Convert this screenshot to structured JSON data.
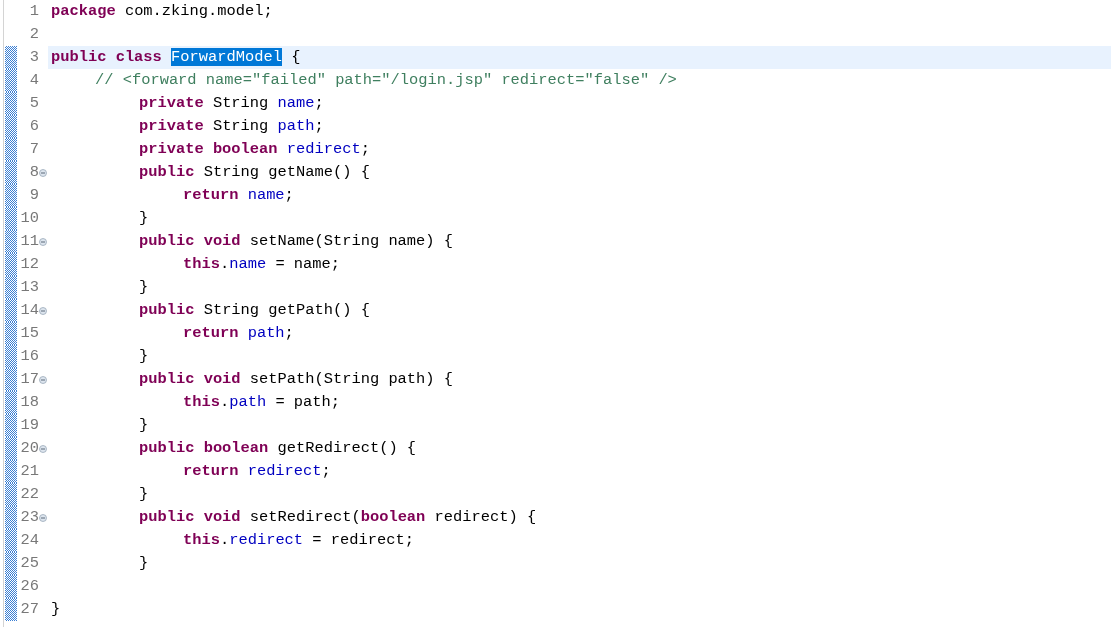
{
  "editor": {
    "lines": [
      {
        "number": "1",
        "foldable": false,
        "changed": false,
        "current": false,
        "tokens": [
          {
            "kind": "keyword",
            "text": "package"
          },
          {
            "kind": "plain",
            "text": " com.zking.model;"
          }
        ]
      },
      {
        "number": "2",
        "foldable": false,
        "changed": false,
        "current": false
      },
      {
        "number": "3",
        "foldable": false,
        "changed": true,
        "current": true,
        "tokens": [
          {
            "kind": "keyword",
            "text": "public class "
          },
          {
            "kind": "plain",
            "text": "ForwardModel",
            "selected": true
          },
          {
            "kind": "plain",
            "text": " {"
          }
        ]
      },
      {
        "number": "4",
        "foldable": false,
        "changed": true,
        "current": false,
        "tokens": [
          {
            "kind": "comment",
            "text": "\t// <forward name=\"failed\" path=\"/login.jsp\" redirect=\"false\" />"
          }
        ]
      },
      {
        "number": "5",
        "foldable": false,
        "changed": true,
        "current": false,
        "tokens": [
          {
            "kind": "keyword",
            "text": "\t\tprivate"
          },
          {
            "kind": "plain",
            "text": " String "
          },
          {
            "kind": "field",
            "text": "name"
          },
          {
            "kind": "plain",
            "text": ";"
          }
        ]
      },
      {
        "number": "6",
        "foldable": false,
        "changed": true,
        "current": false,
        "tokens": [
          {
            "kind": "keyword",
            "text": "\t\tprivate"
          },
          {
            "kind": "plain",
            "text": " String "
          },
          {
            "kind": "field",
            "text": "path"
          },
          {
            "kind": "plain",
            "text": ";"
          }
        ]
      },
      {
        "number": "7",
        "foldable": false,
        "changed": true,
        "current": false,
        "tokens": [
          {
            "kind": "keyword",
            "text": "\t\tprivate boolean"
          },
          {
            "kind": "field",
            "text": " redirect"
          },
          {
            "kind": "plain",
            "text": ";"
          }
        ]
      },
      {
        "number": "8",
        "foldable": true,
        "changed": true,
        "current": false,
        "tokens": [
          {
            "kind": "keyword",
            "text": "\t\tpublic"
          },
          {
            "kind": "plain",
            "text": " String getName() {"
          }
        ]
      },
      {
        "number": "9",
        "foldable": false,
        "changed": true,
        "current": false,
        "tokens": [
          {
            "kind": "keyword",
            "text": "\t\t\treturn"
          },
          {
            "kind": "field",
            "text": " name"
          },
          {
            "kind": "plain",
            "text": ";"
          }
        ]
      },
      {
        "number": "10",
        "foldable": false,
        "changed": true,
        "current": false,
        "tokens": [
          {
            "kind": "plain",
            "text": "\t\t}"
          }
        ]
      },
      {
        "number": "11",
        "foldable": true,
        "changed": true,
        "current": false,
        "tokens": [
          {
            "kind": "keyword",
            "text": "\t\tpublic void"
          },
          {
            "kind": "plain",
            "text": " setName(String name) {"
          }
        ]
      },
      {
        "number": "12",
        "foldable": false,
        "changed": true,
        "current": false,
        "tokens": [
          {
            "kind": "keyword",
            "text": "\t\t\tthis"
          },
          {
            "kind": "plain",
            "text": "."
          },
          {
            "kind": "field",
            "text": "name"
          },
          {
            "kind": "plain",
            "text": " = name;"
          }
        ]
      },
      {
        "number": "13",
        "foldable": false,
        "changed": true,
        "current": false,
        "tokens": [
          {
            "kind": "plain",
            "text": "\t\t}"
          }
        ]
      },
      {
        "number": "14",
        "foldable": true,
        "changed": true,
        "current": false,
        "tokens": [
          {
            "kind": "keyword",
            "text": "\t\tpublic"
          },
          {
            "kind": "plain",
            "text": " String getPath() {"
          }
        ]
      },
      {
        "number": "15",
        "foldable": false,
        "changed": true,
        "current": false,
        "tokens": [
          {
            "kind": "keyword",
            "text": "\t\t\treturn"
          },
          {
            "kind": "field",
            "text": " path"
          },
          {
            "kind": "plain",
            "text": ";"
          }
        ]
      },
      {
        "number": "16",
        "foldable": false,
        "changed": true,
        "current": false,
        "tokens": [
          {
            "kind": "plain",
            "text": "\t\t}"
          }
        ]
      },
      {
        "number": "17",
        "foldable": true,
        "changed": true,
        "current": false,
        "tokens": [
          {
            "kind": "keyword",
            "text": "\t\tpublic void"
          },
          {
            "kind": "plain",
            "text": " setPath(String path) {"
          }
        ]
      },
      {
        "number": "18",
        "foldable": false,
        "changed": true,
        "current": false,
        "tokens": [
          {
            "kind": "keyword",
            "text": "\t\t\tthis"
          },
          {
            "kind": "plain",
            "text": "."
          },
          {
            "kind": "field",
            "text": "path"
          },
          {
            "kind": "plain",
            "text": " = path;"
          }
        ]
      },
      {
        "number": "19",
        "foldable": false,
        "changed": true,
        "current": false,
        "tokens": [
          {
            "kind": "plain",
            "text": "\t\t}"
          }
        ]
      },
      {
        "number": "20",
        "foldable": true,
        "changed": true,
        "current": false,
        "tokens": [
          {
            "kind": "keyword",
            "text": "\t\tpublic boolean"
          },
          {
            "kind": "plain",
            "text": " getRedirect() {"
          }
        ]
      },
      {
        "number": "21",
        "foldable": false,
        "changed": true,
        "current": false,
        "tokens": [
          {
            "kind": "keyword",
            "text": "\t\t\treturn"
          },
          {
            "kind": "field",
            "text": " redirect"
          },
          {
            "kind": "plain",
            "text": ";"
          }
        ]
      },
      {
        "number": "22",
        "foldable": false,
        "changed": true,
        "current": false,
        "tokens": [
          {
            "kind": "plain",
            "text": "\t\t}"
          }
        ]
      },
      {
        "number": "23",
        "foldable": true,
        "changed": true,
        "current": false,
        "tokens": [
          {
            "kind": "keyword",
            "text": "\t\tpublic void"
          },
          {
            "kind": "plain",
            "text": " setRedirect("
          },
          {
            "kind": "keyword",
            "text": "boolean"
          },
          {
            "kind": "plain",
            "text": " redirect) {"
          }
        ]
      },
      {
        "number": "24",
        "foldable": false,
        "changed": true,
        "current": false,
        "tokens": [
          {
            "kind": "keyword",
            "text": "\t\t\tthis"
          },
          {
            "kind": "plain",
            "text": "."
          },
          {
            "kind": "field",
            "text": "redirect"
          },
          {
            "kind": "plain",
            "text": " = redirect;"
          }
        ]
      },
      {
        "number": "25",
        "foldable": false,
        "changed": true,
        "current": false,
        "tokens": [
          {
            "kind": "plain",
            "text": "\t\t}"
          }
        ]
      },
      {
        "number": "26",
        "foldable": false,
        "changed": true,
        "current": false
      },
      {
        "number": "27",
        "foldable": false,
        "changed": true,
        "current": false,
        "tokens": [
          {
            "kind": "plain",
            "text": "}"
          }
        ]
      }
    ]
  }
}
